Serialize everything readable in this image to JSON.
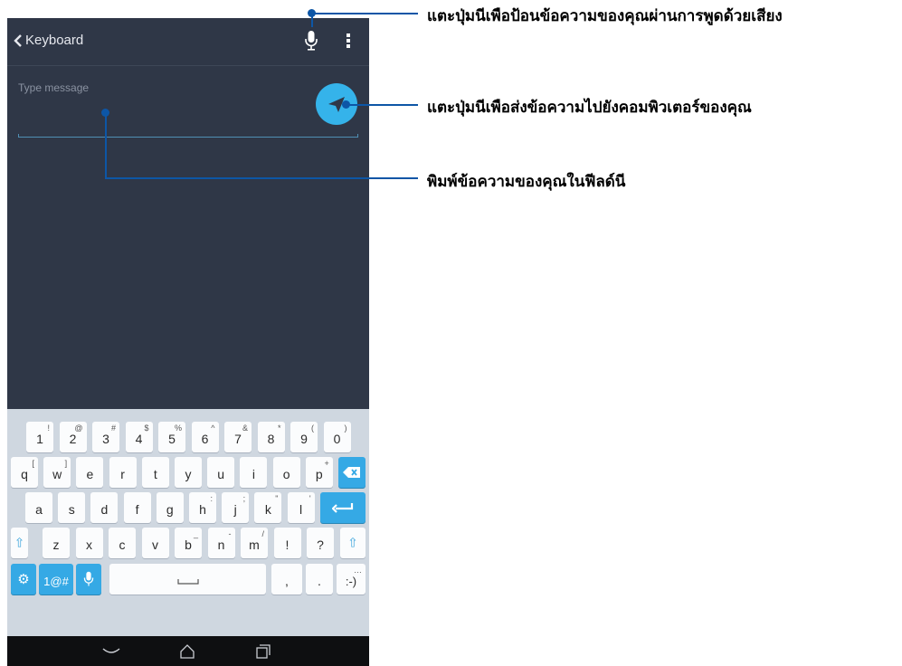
{
  "app": {
    "back_label": "Keyboard"
  },
  "message_field": {
    "placeholder": "Type message"
  },
  "keyboard": {
    "number_row": [
      {
        "main": "1",
        "sup": "!"
      },
      {
        "main": "2",
        "sup": "@"
      },
      {
        "main": "3",
        "sup": "#"
      },
      {
        "main": "4",
        "sup": "$"
      },
      {
        "main": "5",
        "sup": "%"
      },
      {
        "main": "6",
        "sup": "^"
      },
      {
        "main": "7",
        "sup": "&"
      },
      {
        "main": "8",
        "sup": "*"
      },
      {
        "main": "9",
        "sup": "("
      },
      {
        "main": "0",
        "sup": ")"
      }
    ],
    "row_q": [
      {
        "main": "q",
        "sup": "["
      },
      {
        "main": "w",
        "sup": "]"
      },
      {
        "main": "e",
        "sup": ""
      },
      {
        "main": "r",
        "sup": ""
      },
      {
        "main": "t",
        "sup": ""
      },
      {
        "main": "y",
        "sup": ""
      },
      {
        "main": "u",
        "sup": ""
      },
      {
        "main": "i",
        "sup": ""
      },
      {
        "main": "o",
        "sup": ""
      },
      {
        "main": "p",
        "sup": "+"
      }
    ],
    "row_a": [
      {
        "main": "a",
        "sup": ""
      },
      {
        "main": "s",
        "sup": ""
      },
      {
        "main": "d",
        "sup": ""
      },
      {
        "main": "f",
        "sup": ""
      },
      {
        "main": "g",
        "sup": ""
      },
      {
        "main": "h",
        "sup": ":"
      },
      {
        "main": "j",
        "sup": ";"
      },
      {
        "main": "k",
        "sup": "\""
      },
      {
        "main": "l",
        "sup": "'"
      }
    ],
    "row_z": [
      {
        "main": "z",
        "sup": ""
      },
      {
        "main": "x",
        "sup": ""
      },
      {
        "main": "c",
        "sup": ""
      },
      {
        "main": "v",
        "sup": ""
      },
      {
        "main": "b",
        "sup": "_"
      },
      {
        "main": "n",
        "sup": "-"
      },
      {
        "main": "m",
        "sup": "/"
      },
      {
        "main": "!",
        "sup": ""
      },
      {
        "main": "?",
        "sup": ""
      }
    ],
    "symbols_label": "1@#",
    "comma_label": ",",
    "period_label": ".",
    "smiley_label": ":-)",
    "smiley_sup": "…"
  },
  "callouts": {
    "voice": "แตะปุ่มนีเพือป้อนข้อความของคุณผ่านการพูดด้วยเสียง",
    "send": "แตะปุ่มนีเพือส่งข้อความไปยังคอมพิวเตอร์ของคุณ",
    "field": "พิมพ์ข้อความของคุณในฟีลด์นี"
  },
  "colors": {
    "screen_bg": "#2f3747",
    "accent": "#35b3ea",
    "keyboard_bg": "#cfd7e0",
    "callout": "#0d56a6"
  },
  "icons": [
    "chevron-left-icon",
    "microphone-icon",
    "overflow-menu-icon",
    "send-icon",
    "backspace-icon",
    "enter-icon",
    "shift-icon",
    "gear-icon",
    "space-icon",
    "nav-back-icon",
    "nav-home-icon",
    "nav-recents-icon"
  ]
}
